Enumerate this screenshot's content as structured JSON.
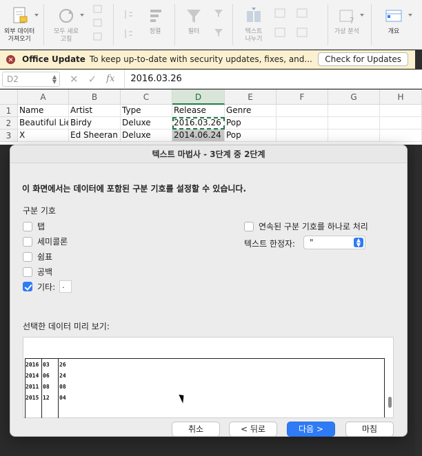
{
  "ribbon": {
    "external_data": "외부 데이터\n가져오기",
    "refresh_all": "모두 새로\n고침",
    "sort": "정렬",
    "filter": "필터",
    "text_to_columns": "텍스트\n나누기",
    "what_if": "가상 분석",
    "outline": "개요"
  },
  "update_bar": {
    "title": "Office Update",
    "message": "To keep up-to-date with security updates, fixes, and...",
    "button": "Check for Updates"
  },
  "formula_bar": {
    "name_box": "D2",
    "fx": "fx",
    "value": "2016.03.26"
  },
  "grid": {
    "columns": [
      "A",
      "B",
      "C",
      "D",
      "E",
      "F",
      "G",
      "H"
    ],
    "rows": [
      "1",
      "2",
      "3"
    ],
    "cells": [
      [
        "Name",
        "Artist",
        "Type",
        "Release",
        "Genre"
      ],
      [
        "Beautiful Lies",
        "Birdy",
        "Deluxe",
        "2016.03.26",
        "Pop"
      ],
      [
        "X",
        "Ed Sheeran",
        "Deluxe",
        "2014.06.24",
        "Pop"
      ]
    ]
  },
  "dialog": {
    "title": "텍스트 마법사 - 3단계 중 2단계",
    "instruction": "이 화면에서는 데이터에 포함된 구분 기호를 설정할 수 있습니다.",
    "delimiters_label": "구분 기호",
    "tab": "탭",
    "semicolon": "세미콜론",
    "comma": "쉼표",
    "space": "공백",
    "other": "기타:",
    "other_value": ".",
    "consecutive": "연속된 구분 기호를 하나로 처리",
    "qualifier_label": "텍스트 한정자:",
    "qualifier_value": "\"",
    "preview_label": "선택한 데이터 미리 보기:",
    "preview_rows": [
      [
        "2016",
        "03",
        "26"
      ],
      [
        "2014",
        "06",
        "24"
      ],
      [
        "2011",
        "08",
        "08"
      ],
      [
        "2015",
        "12",
        "04"
      ]
    ],
    "cancel": "취소",
    "back": "< 뒤로",
    "next": "다음 >",
    "finish": "마침"
  }
}
